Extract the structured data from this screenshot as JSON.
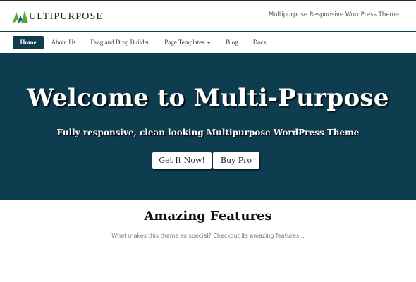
{
  "header": {
    "logo_text": "ULTIPURPOSE",
    "tagline": "Multipurpose Responsive WordPress Theme"
  },
  "nav": {
    "items": [
      {
        "label": "Home",
        "active": true
      },
      {
        "label": "About Us"
      },
      {
        "label": "Drag and Drop Builder"
      },
      {
        "label": "Page Templates",
        "has_dropdown": true
      },
      {
        "label": "Blog"
      },
      {
        "label": "Docs"
      }
    ]
  },
  "hero": {
    "title": "Welcome to Multi-Purpose",
    "subtitle": "Fully responsive, clean looking Multipurpose WordPress Theme",
    "buttons": [
      {
        "label": "Get It Now!"
      },
      {
        "label": "Buy Pro"
      }
    ]
  },
  "features": {
    "title": "Amazing Features",
    "subtitle": "What makes this theme so special? Checkout its amazing features..."
  },
  "colors": {
    "primary": "#0f3d50",
    "logo_green": "#5aa832",
    "logo_blue": "#1f5f8b"
  }
}
